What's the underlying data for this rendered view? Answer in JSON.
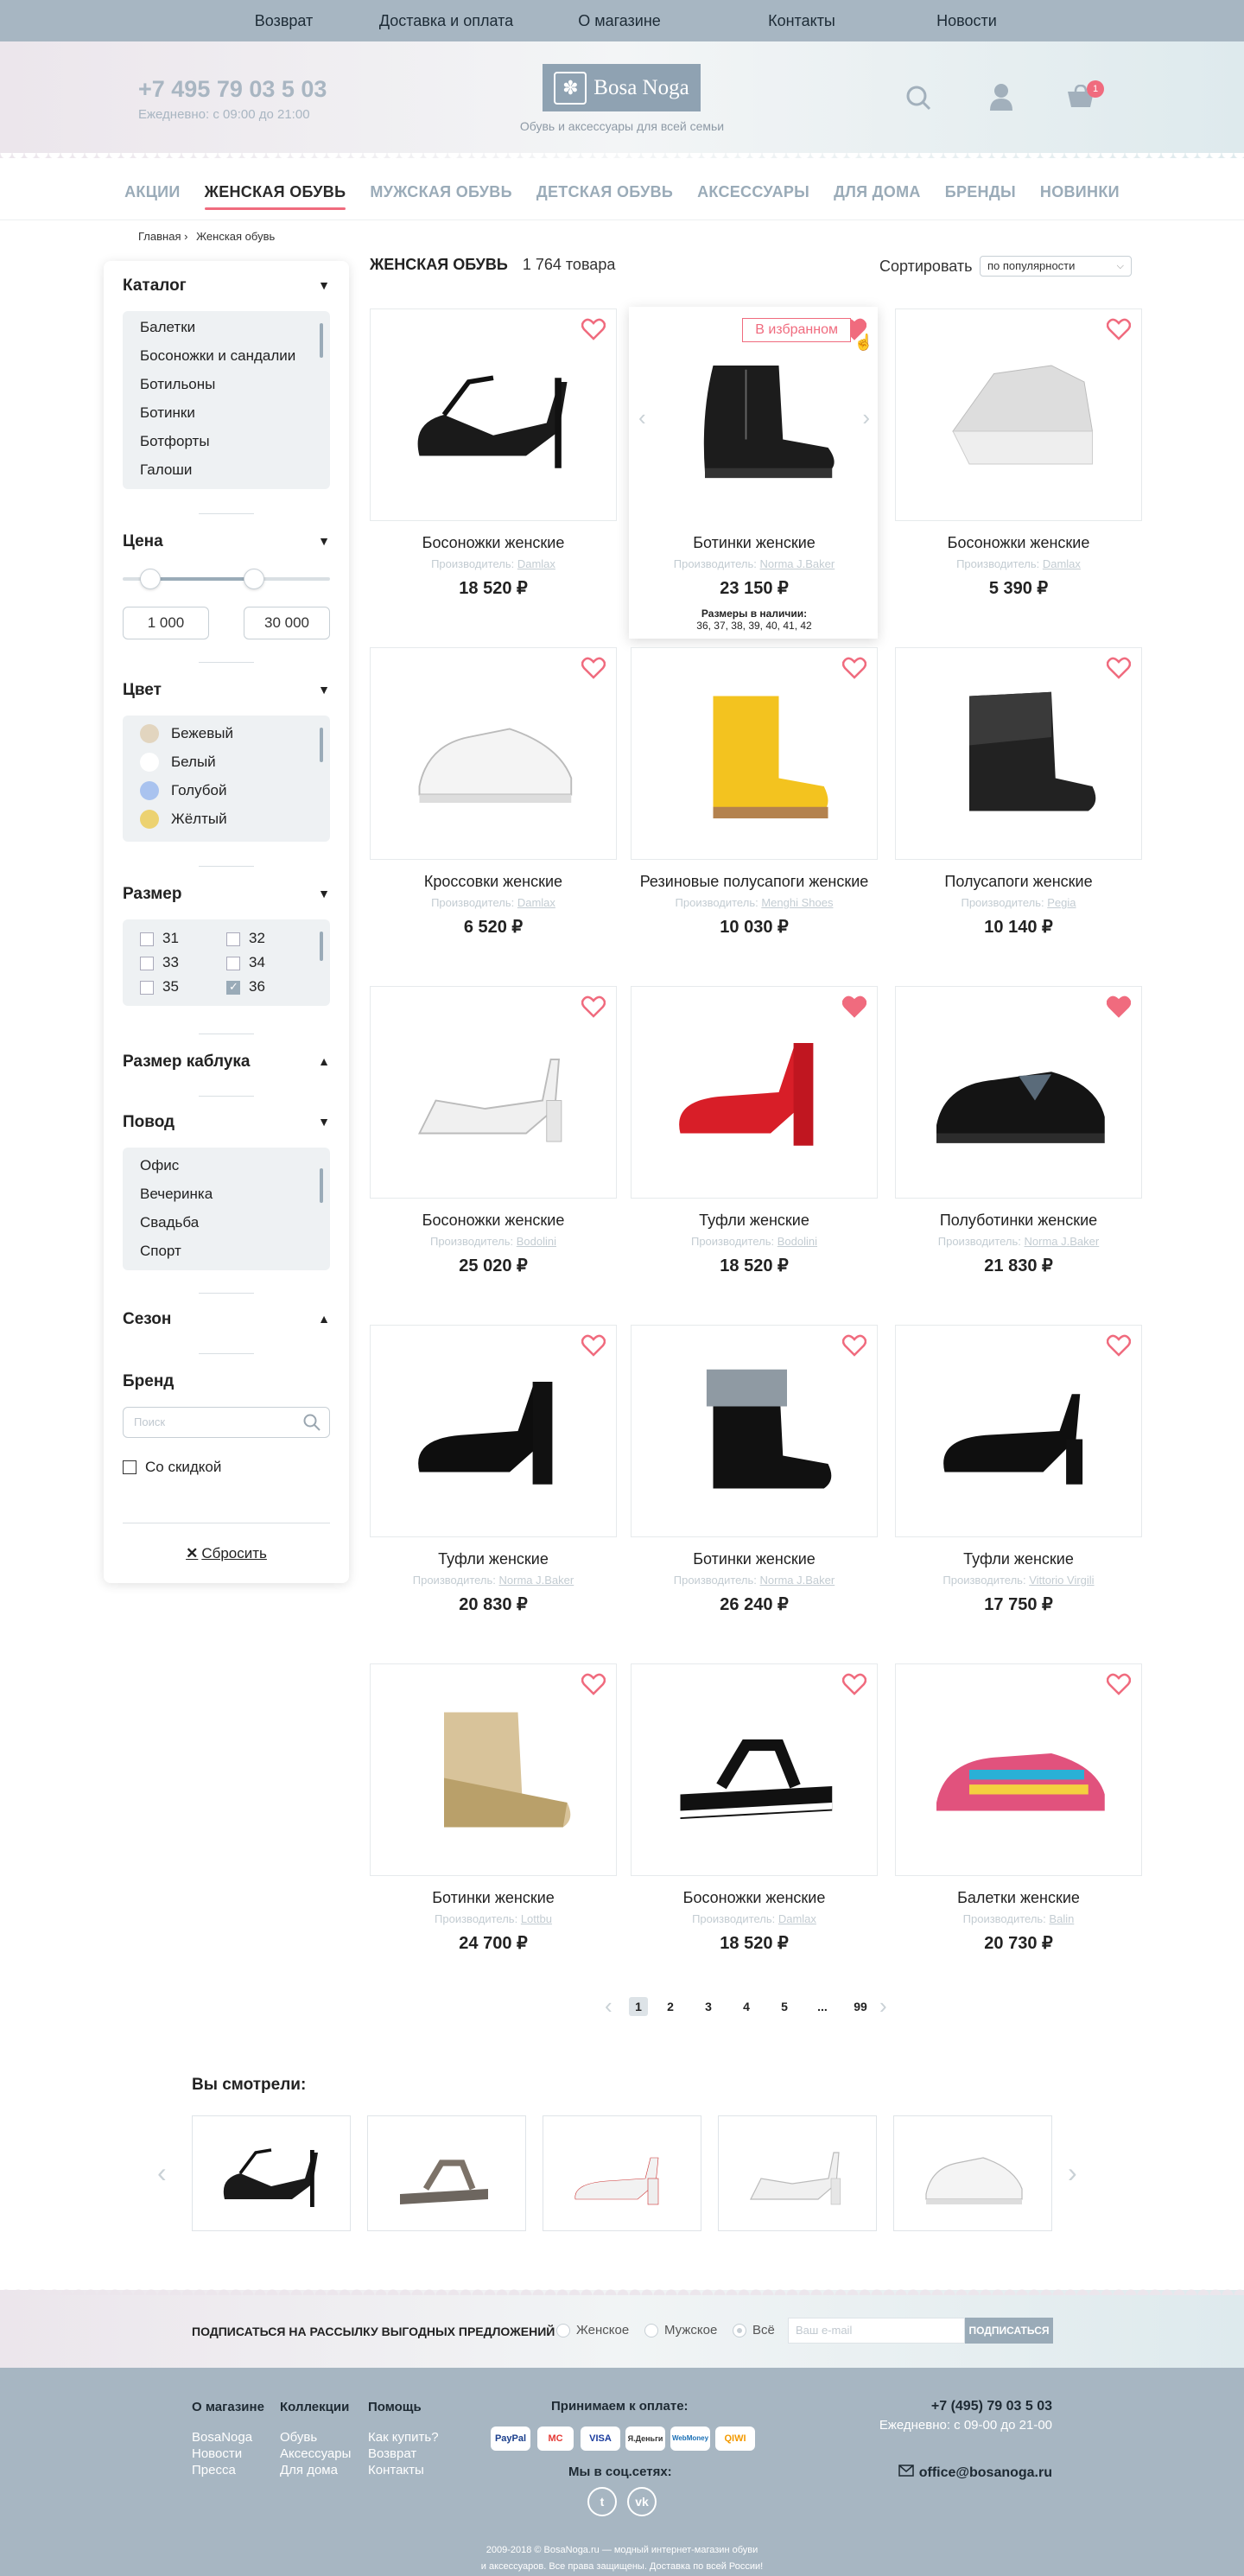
{
  "topbar": [
    "Возврат",
    "Доставка и оплата",
    "О магазине",
    "Контакты",
    "Новости"
  ],
  "header": {
    "phone": "+7 495 79 03 5 03",
    "hours": "Ежедневно: с 09:00 до 21:00",
    "logo": "Bosa Noga",
    "tagline": "Обувь и аксессуары для всей семьи",
    "cart_count": "1"
  },
  "catnav": [
    "АКЦИИ",
    "ЖЕНСКАЯ ОБУВЬ",
    "МУЖСКАЯ ОБУВЬ",
    "ДЕТСКАЯ ОБУВЬ",
    "АКСЕССУАРЫ",
    "ДЛЯ ДОМА",
    "БРЕНДЫ",
    "НОВИНКИ"
  ],
  "breadcrumb": [
    "Главная",
    "Женская обувь"
  ],
  "filters": {
    "catalog": {
      "title": "Каталог",
      "items": [
        "Балетки",
        "Босоножки и сандалии",
        "Ботильоны",
        "Ботинки",
        "Ботфорты",
        "Галоши"
      ]
    },
    "price": {
      "title": "Цена",
      "min": "1 000",
      "max": "30 000"
    },
    "color": {
      "title": "Цвет",
      "items": [
        {
          "name": "Бежевый",
          "hex": "#e2d5bf"
        },
        {
          "name": "Белый",
          "hex": "#ffffff"
        },
        {
          "name": "Голубой",
          "hex": "#a9c3ef"
        },
        {
          "name": "Жёлтый",
          "hex": "#ecd271"
        }
      ]
    },
    "size": {
      "title": "Размер",
      "items": [
        {
          "v": "31",
          "on": false
        },
        {
          "v": "32",
          "on": false
        },
        {
          "v": "33",
          "on": false
        },
        {
          "v": "34",
          "on": false
        },
        {
          "v": "35",
          "on": false
        },
        {
          "v": "36",
          "on": true
        }
      ]
    },
    "heel": {
      "title": "Размер каблука"
    },
    "occasion": {
      "title": "Повод",
      "items": [
        "Офис",
        "Вечеринка",
        "Свадьба",
        "Спорт"
      ]
    },
    "season": {
      "title": "Сезон"
    },
    "brand": {
      "title": "Бренд",
      "placeholder": "Поиск"
    },
    "discount": "Со скидкой",
    "reset": "Сбросить"
  },
  "list": {
    "title": "ЖЕНСКАЯ ОБУВЬ",
    "count": "1 764 товара",
    "sort_label": "Сортировать",
    "sort_value": "по популярности",
    "maker_label": "Производитель:",
    "fav_label": "В избранном",
    "sizes_label": "Размеры в наличии:",
    "sizes": "36, 37, 38, 39, 40, 41, 42"
  },
  "products": [
    {
      "name": "Босоножки женские",
      "maker": "Damlax",
      "price": "18 520 ₽",
      "fav": false,
      "shoe": "sandal-black"
    },
    {
      "name": "Ботинки женские",
      "maker": "Norma J.Baker",
      "price": "23 150 ₽",
      "fav": true,
      "shoe": "boot-black"
    },
    {
      "name": "Босоножки женские",
      "maker": "Damlax",
      "price": "5 390 ₽",
      "fav": false,
      "shoe": "wedge-white"
    },
    {
      "name": "Кроссовки женские",
      "maker": "Damlax",
      "price": "6 520 ₽",
      "fav": false,
      "shoe": "sneaker-white"
    },
    {
      "name": "Резиновые полусапоги женские",
      "maker": "Menghi Shoes",
      "price": "10 030 ₽",
      "fav": false,
      "shoe": "rubber-yellow"
    },
    {
      "name": "Полусапоги женские",
      "maker": "Pegia",
      "price": "10 140 ₽",
      "fav": false,
      "shoe": "fur-boot"
    },
    {
      "name": "Босоножки женские",
      "maker": "Bodolini",
      "price": "25 020 ₽",
      "fav": false,
      "shoe": "sandal-white"
    },
    {
      "name": "Туфли женские",
      "maker": "Bodolini",
      "price": "18 520 ₽",
      "fav": true,
      "shoe": "pump-red"
    },
    {
      "name": "Полуботинки женские",
      "maker": "Norma J.Baker",
      "price": "21 830 ₽",
      "fav": true,
      "shoe": "loafer-black"
    },
    {
      "name": "Туфли женские",
      "maker": "Norma J.Baker",
      "price": "20 830 ₽",
      "fav": false,
      "shoe": "pump-patent"
    },
    {
      "name": "Ботинки женские",
      "maker": "Norma J.Baker",
      "price": "26 240 ₽",
      "fav": false,
      "shoe": "boot-fur"
    },
    {
      "name": "Туфли женские",
      "maker": "Vittorio Virgili",
      "price": "17 750 ₽",
      "fav": false,
      "shoe": "pump-classic"
    },
    {
      "name": "Ботинки женские",
      "maker": "Lottbu",
      "price": "24 700 ₽",
      "fav": false,
      "shoe": "boot-gold"
    },
    {
      "name": "Босоножки женские",
      "maker": "Damlax",
      "price": "18 520 ₽",
      "fav": false,
      "shoe": "sandal-flat"
    },
    {
      "name": "Балетки женские",
      "maker": "Balin",
      "price": "20 730 ₽",
      "fav": false,
      "shoe": "espadrille"
    }
  ],
  "pager": [
    "1",
    "2",
    "3",
    "4",
    "5",
    "...",
    "99"
  ],
  "seen": {
    "title": "Вы смотрели:",
    "items": [
      "sandal-black",
      "sandal-gray",
      "sandal-red",
      "sandal-white",
      "sneaker-white"
    ]
  },
  "subscribe": {
    "text": "ПОДПИСАТЬСЯ НА РАССЫЛКУ ВЫГОДНЫХ ПРЕДЛОЖЕНИЙ",
    "options": [
      "Женское",
      "Мужское",
      "Всё"
    ],
    "placeholder": "Ваш e-mail",
    "button": "ПОДПИСАТЬСЯ"
  },
  "footer": {
    "col1": {
      "title": "О магазине",
      "items": [
        "BosaNoga",
        "Новости",
        "Пресса"
      ]
    },
    "col2": {
      "title": "Коллекции",
      "items": [
        "Обувь",
        "Аксессуары",
        "Для дома"
      ]
    },
    "col3": {
      "title": "Помощь",
      "items": [
        "Как купить?",
        "Возврат",
        "Контакты"
      ]
    },
    "pay_title": "Принимаем к оплате:",
    "pay": [
      "PayPal",
      "MC",
      "VISA",
      "Я.Деньги",
      "WebMoney",
      "QIWI"
    ],
    "social_title": "Мы в соц.сетях:",
    "phone": "+7 (495) 79 03 5 03",
    "hours": "Ежедневно: с 09-00 до 21-00",
    "email": "office@bosanoga.ru",
    "copy1": "2009-2018 © BosaNoga.ru — модный интернет-магазин обуви",
    "copy2": "и аксессуаров. Все права защищены. Доставка по всей России!"
  },
  "accent": "#f06b7e"
}
